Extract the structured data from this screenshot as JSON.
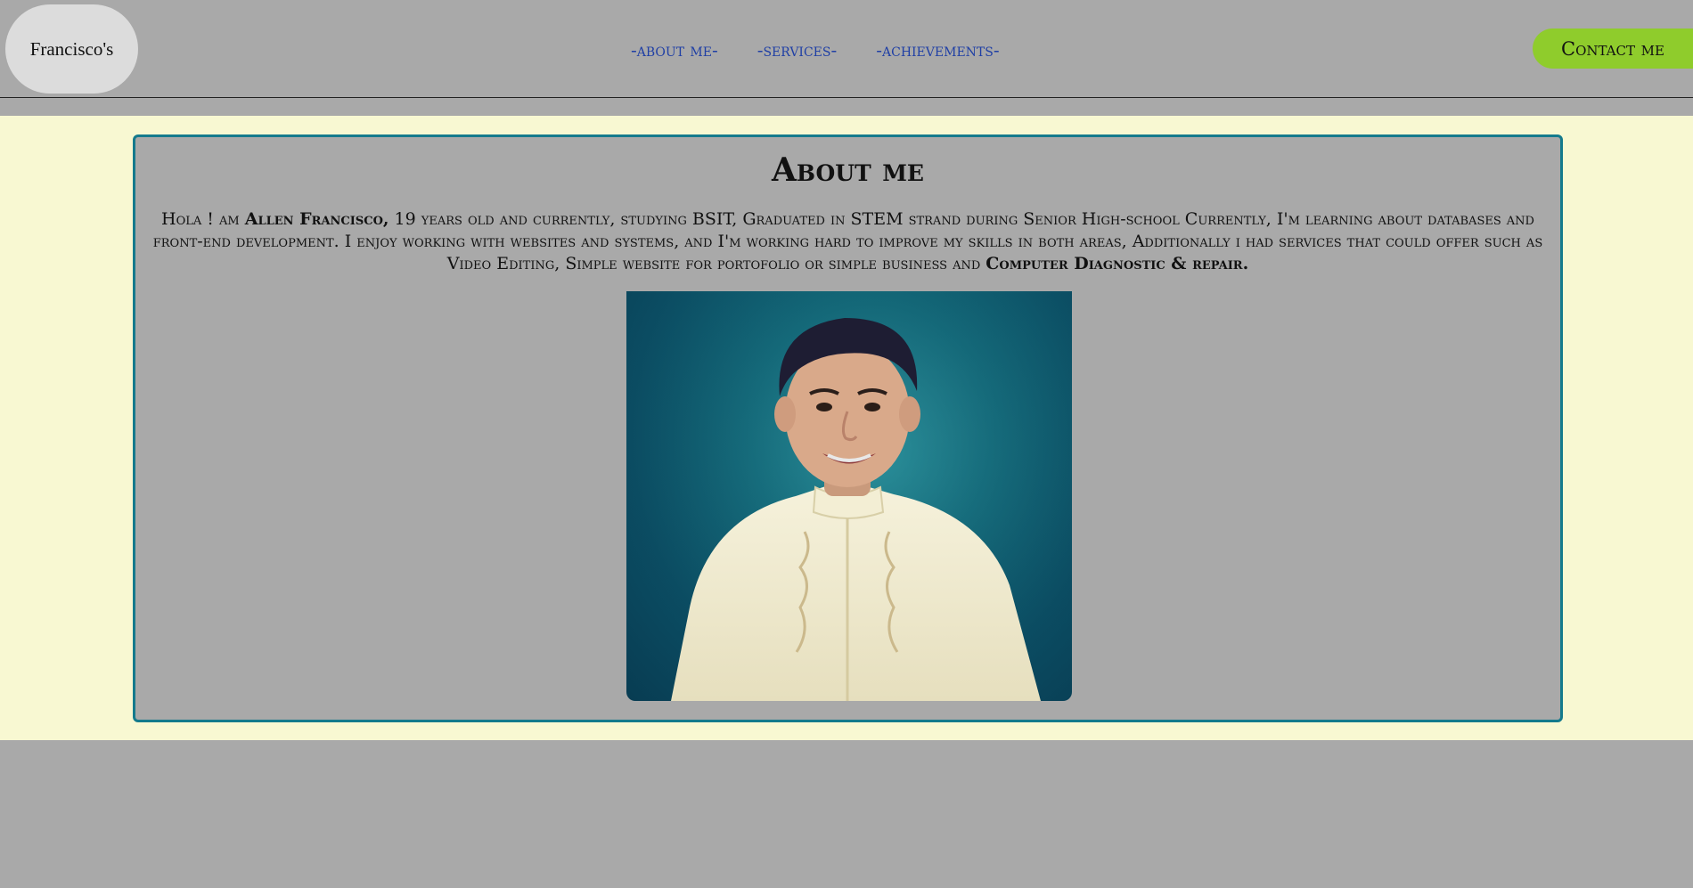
{
  "header": {
    "logo_text": "Francisco's",
    "nav": [
      {
        "label": "-about me-"
      },
      {
        "label": "-services-"
      },
      {
        "label": "-achievements-"
      }
    ],
    "contact_label": "Contact me"
  },
  "about": {
    "title": "About me",
    "bio_parts": {
      "p1": "Hola ! am ",
      "name": "Allen Francisco,",
      "p2": " 19 years old and currently, studying BSIT, Graduated in STEM strand during Senior High-school Currently, I'm learning about databases and front-end development. I enjoy working with websites and systems, and I'm working hard to improve my skills in both areas, Additionally i had services that could offer such as Video Editing, Simple website for portofolio or simple business and ",
      "repair": "Computer Diagnostic & repair."
    }
  },
  "colors": {
    "page_bg": "#a9a9a9",
    "band_bg": "#f8f8d2",
    "card_border": "#147a8c",
    "nav_link": "#1f3fa5",
    "contact_button": "#8fcc2c"
  }
}
